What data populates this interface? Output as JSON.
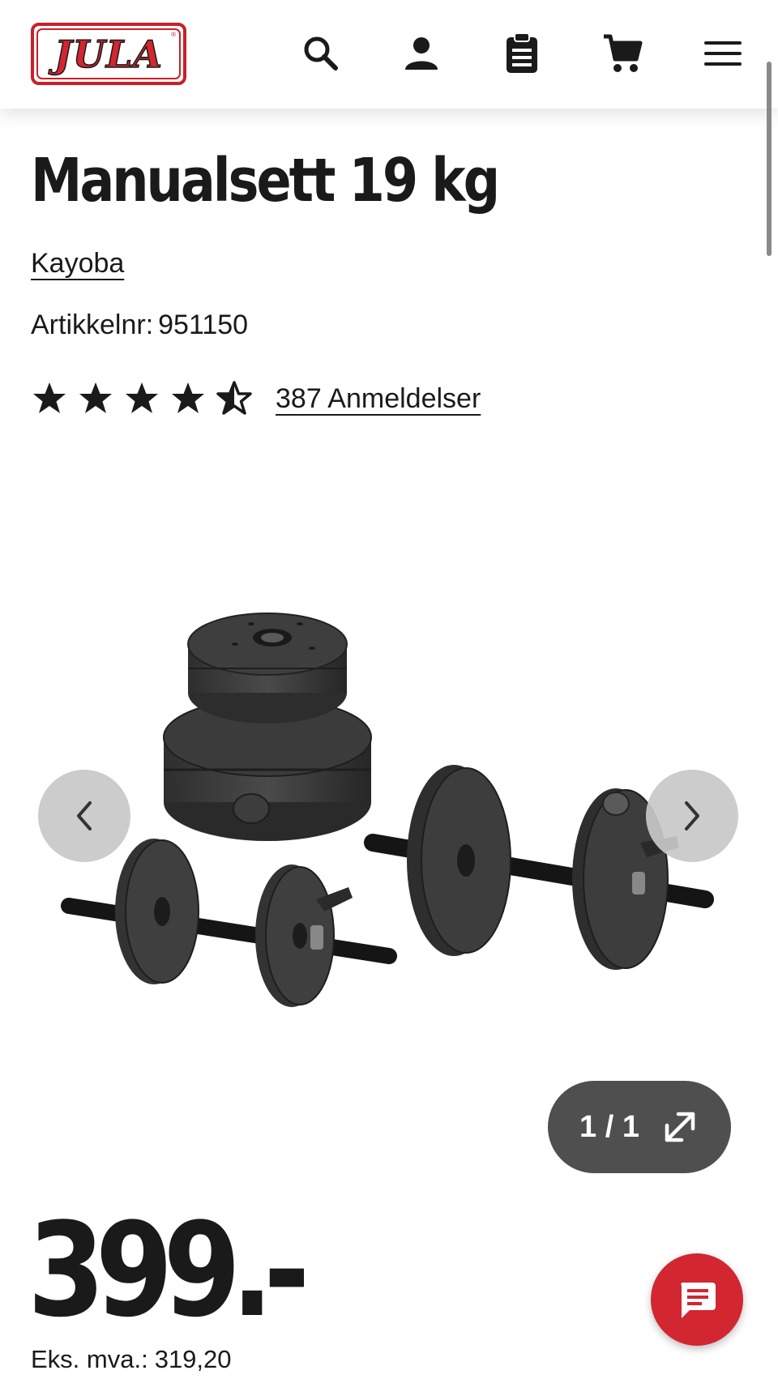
{
  "header": {
    "logo_text": "JULA",
    "logo_mark": "®",
    "icons": [
      "search-icon",
      "account-icon",
      "shopping-list-icon",
      "cart-icon",
      "menu-icon"
    ]
  },
  "product": {
    "title": "Manualsett 19 kg",
    "brand": "Kayoba",
    "article_label": "Artikkelnr:",
    "article_number": "951150",
    "rating": 4.5,
    "rating_max": 5,
    "reviews_label": "387 Anmeldelser"
  },
  "gallery": {
    "counter": "1 / 1",
    "prev_icon": "chevron-left-icon",
    "next_icon": "chevron-right-icon",
    "expand_icon": "expand-icon"
  },
  "pricing": {
    "price": "399.-",
    "ex_vat_label": "Eks. mva.:",
    "ex_vat_value": "319,20"
  },
  "colors": {
    "brand_red": "#d22630",
    "text": "#1a1a1a",
    "counter_bg": "#4f4f4f",
    "nav_button_bg": "#c8c8c8"
  }
}
